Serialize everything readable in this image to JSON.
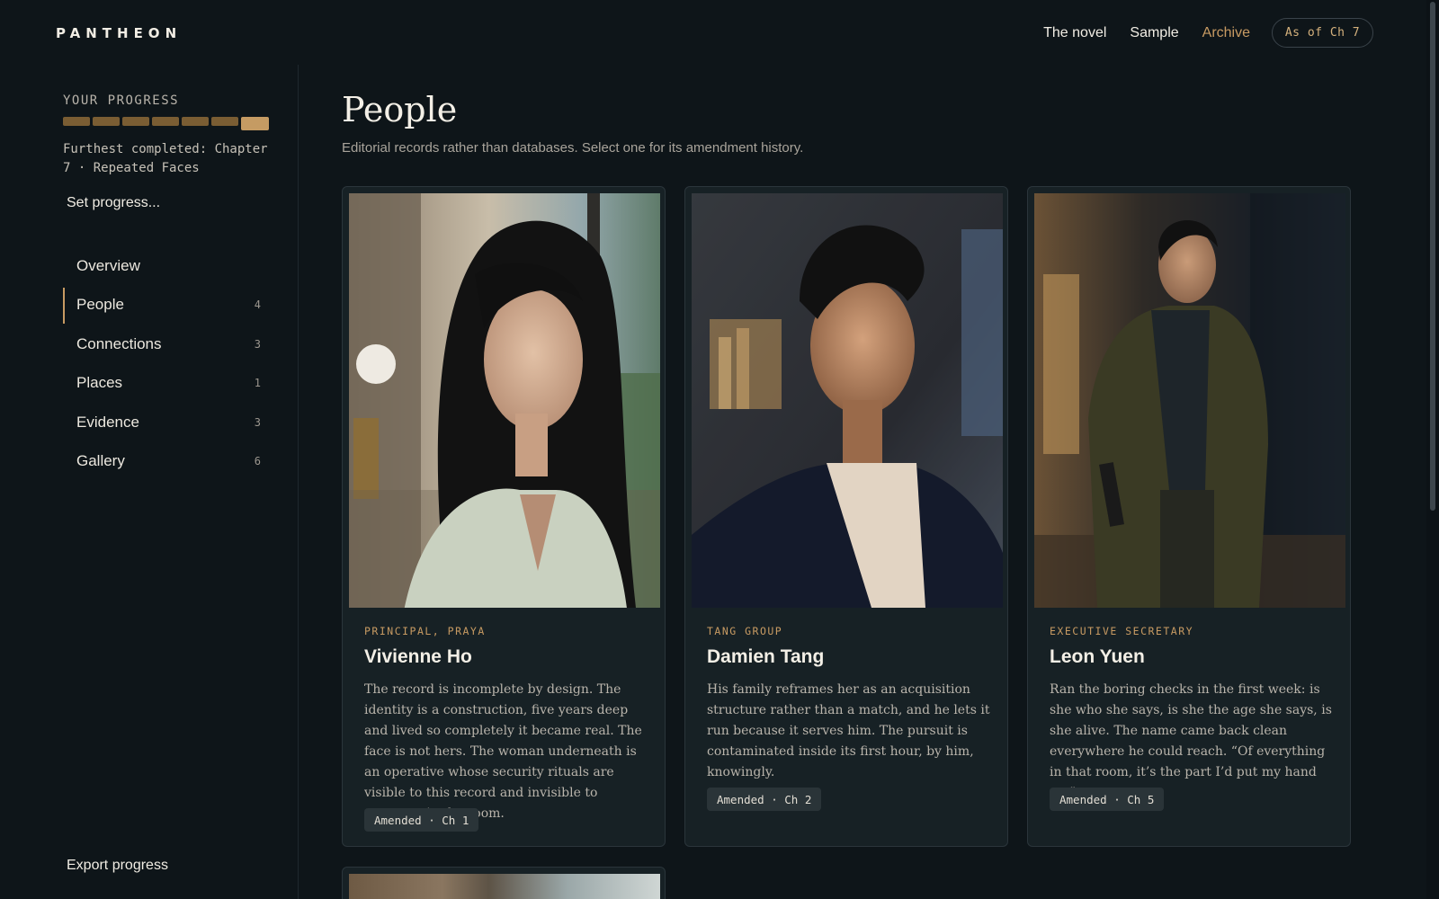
{
  "brand": "PANTHEON",
  "topnav": [
    {
      "label": "The novel",
      "active": false
    },
    {
      "label": "Sample",
      "active": false
    },
    {
      "label": "Archive",
      "active": true
    }
  ],
  "as_of": "As of Ch 7",
  "sidebar": {
    "progress_label": "YOUR PROGRESS",
    "progress": {
      "completed_chapters": 7,
      "total_segments": 7
    },
    "furthest": "Furthest completed: Chapter 7 · Repeated Faces",
    "set_progress": "Set progress...",
    "nav": [
      {
        "label": "Overview",
        "count": ""
      },
      {
        "label": "People",
        "count": "4"
      },
      {
        "label": "Connections",
        "count": "3"
      },
      {
        "label": "Places",
        "count": "1"
      },
      {
        "label": "Evidence",
        "count": "3"
      },
      {
        "label": "Gallery",
        "count": "6"
      }
    ],
    "active_nav": "People",
    "export": "Export progress"
  },
  "main": {
    "title": "People",
    "subtitle": "Editorial records rather than databases. Select one for its amendment history.",
    "cards": [
      {
        "role": "PRINCIPAL, PRAYA",
        "name": "Vivienne Ho",
        "description": "The record is incomplete by design. The identity is a construction, five years deep and lived so completely it became real. The face is not hers. The woman underneath is an operative whose security rituals are visible to this record and invisible to everyone in the room.",
        "badge": "Amended · Ch 1"
      },
      {
        "role": "TANG GROUP",
        "name": "Damien Tang",
        "description": "His family reframes her as an acquisition structure rather than a match, and he lets it run because it serves him. The pursuit is contaminated inside its first hour, by him, knowingly.",
        "badge": "Amended · Ch 2"
      },
      {
        "role": "EXECUTIVE SECRETARY",
        "name": "Leon Yuen",
        "description": "Ran the boring checks in the first week: is she who she says, is she the age she says, is she alive. The name came back clean everywhere he could reach. “Of everything in that room, it’s the part I’d put my hand on.”",
        "badge": "Amended · Ch 5"
      }
    ]
  }
}
